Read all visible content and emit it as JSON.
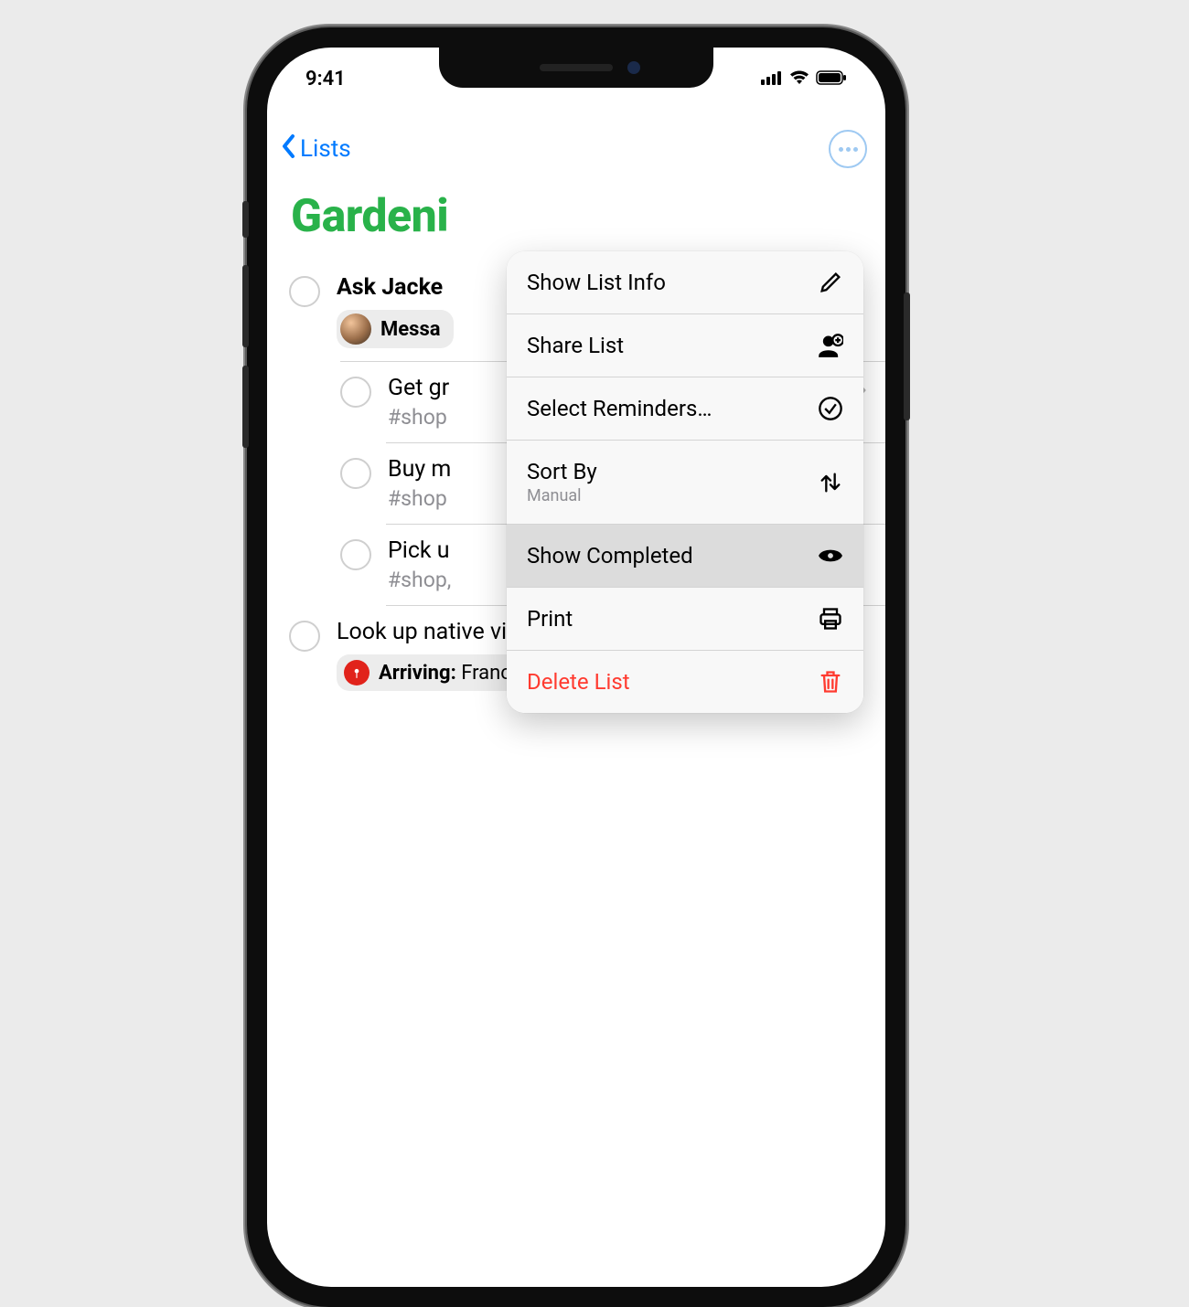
{
  "status": {
    "time": "9:41"
  },
  "nav": {
    "back_label": "Lists"
  },
  "list": {
    "title": "Gardeni",
    "accent_color": "#29b24a"
  },
  "reminders": [
    {
      "title": "Ask Jacke",
      "tag": "",
      "has_message_badge": true,
      "badge_label_prefix": "Messa"
    },
    {
      "title": "Get gr",
      "tag": "#shop",
      "sub": true,
      "has_chevron": true
    },
    {
      "title": "Buy m",
      "tag": "#shop",
      "sub": true
    },
    {
      "title": "Pick u",
      "tag": "#shop,",
      "sub": true
    },
    {
      "title": "Look up native vines for along the fence",
      "tag": "",
      "has_location_badge": true,
      "location_label": "Arriving:",
      "location_value": " Francine's Home"
    }
  ],
  "menu": {
    "items": [
      {
        "label": "Show List Info",
        "icon": "pencil"
      },
      {
        "label": "Share List",
        "icon": "person-plus"
      },
      {
        "label": "Select Reminders…",
        "icon": "check-circle"
      },
      {
        "label": "Sort By",
        "sub": "Manual",
        "icon": "arrows-updown"
      },
      {
        "label": "Show Completed",
        "icon": "eye",
        "selected": true
      },
      {
        "label": "Print",
        "icon": "printer"
      },
      {
        "label": "Delete List",
        "icon": "trash",
        "danger": true
      }
    ]
  }
}
